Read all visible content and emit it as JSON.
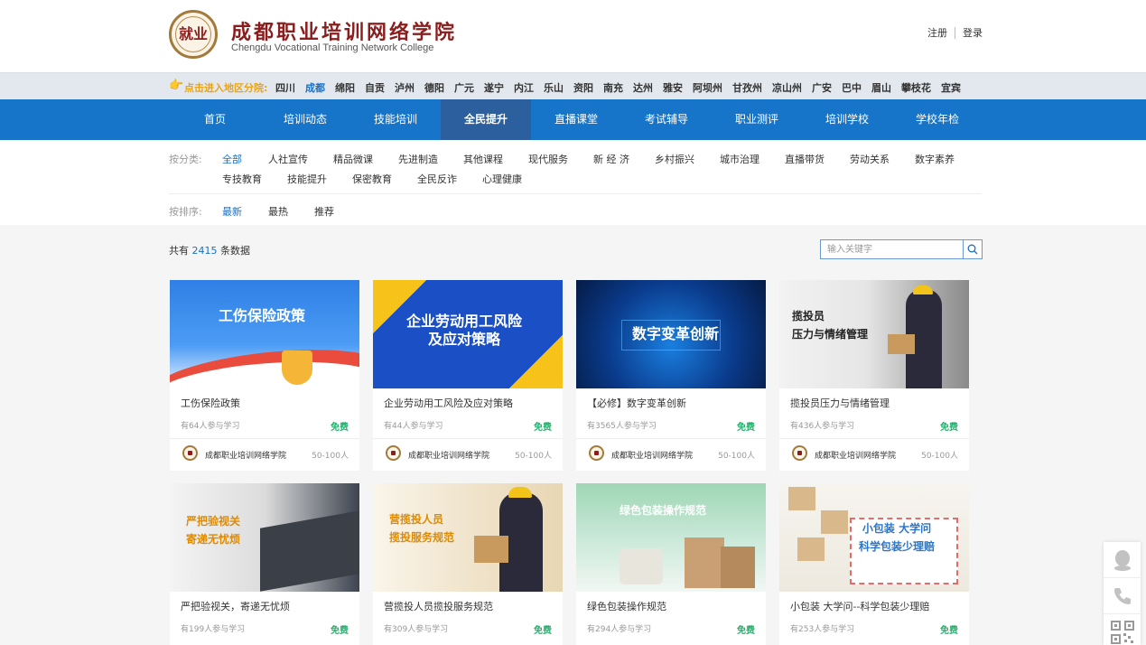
{
  "header": {
    "logo_text": "就业",
    "title_cn": "成都职业培训网络学院",
    "title_en": "Chengdu Vocational Training Network College",
    "register": "注册",
    "login": "登录"
  },
  "region_bar": {
    "label": "点击进入地区分院:",
    "regions": [
      "四川",
      "成都",
      "绵阳",
      "自贡",
      "泸州",
      "德阳",
      "广元",
      "遂宁",
      "内江",
      "乐山",
      "资阳",
      "南充",
      "达州",
      "雅安",
      "阿坝州",
      "甘孜州",
      "凉山州",
      "广安",
      "巴中",
      "眉山",
      "攀枝花",
      "宜宾"
    ],
    "active": "成都"
  },
  "nav": {
    "items": [
      "首页",
      "培训动态",
      "技能培训",
      "全民提升",
      "直播课堂",
      "考试辅导",
      "职业测评",
      "培训学校",
      "学校年检"
    ],
    "active": "全民提升"
  },
  "filter": {
    "category_label": "按分类:",
    "categories_row1": [
      "全部",
      "人社宣传",
      "精品微课",
      "先进制造",
      "其他课程",
      "现代服务",
      "新 经 济",
      "乡村振兴",
      "城市治理",
      "直播带货",
      "劳动关系",
      "数字素养"
    ],
    "categories_row2": [
      "专技教育",
      "技能提升",
      "保密教育",
      "全民反诈",
      "心理健康"
    ],
    "active_category": "全部",
    "sort_label": "按排序:",
    "sorts": [
      "最新",
      "最热",
      "推荐"
    ],
    "active_sort": "最新"
  },
  "results": {
    "prefix": "共有",
    "count": "2415",
    "suffix": "条数据"
  },
  "search": {
    "placeholder": "输入关键字"
  },
  "cards": [
    {
      "thumb_text": "工伤保险政策",
      "title": "工伤保险政策",
      "learners": "有64人参与学习",
      "price": "免费",
      "org": "成都职业培训网络学院",
      "size": "50-100人"
    },
    {
      "thumb_text": "企业劳动用工风险\n及应对策略",
      "title": "企业劳动用工风险及应对策略",
      "learners": "有44人参与学习",
      "price": "免费",
      "org": "成都职业培训网络学院",
      "size": "50-100人"
    },
    {
      "thumb_text": "数字变革创新",
      "title": "【必修】数字变革创新",
      "learners": "有3565人参与学习",
      "price": "免费",
      "org": "成都职业培训网络学院",
      "size": "50-100人"
    },
    {
      "thumb_text": "揽投员\n压力与情绪管理",
      "title": "揽投员压力与情绪管理",
      "learners": "有436人参与学习",
      "price": "免费",
      "org": "成都职业培训网络学院",
      "size": "50-100人"
    },
    {
      "thumb_text": "严把验视关\n寄递无忧烦",
      "title": "严把验视关，寄递无忧烦",
      "learners": "有199人参与学习",
      "price": "免费"
    },
    {
      "thumb_text": "营揽投人员\n揽投服务规范",
      "title": "营揽投人员揽投服务规范",
      "learners": "有309人参与学习",
      "price": "免费"
    },
    {
      "thumb_text": "绿色包装操作规范",
      "title": "绿色包装操作规范",
      "learners": "有294人参与学习",
      "price": "免费"
    },
    {
      "thumb_text": "小包装 大学问\n科学包装少理赔",
      "title": "小包装 大学问--科学包装少理赔",
      "learners": "有253人参与学习",
      "price": "免费"
    }
  ],
  "colors": {
    "primary": "#1775c9",
    "nav_active": "#2c5f9e",
    "link_active": "#1a6fc4",
    "free": "#27b06e",
    "region_label": "#e8a317",
    "brand_red": "#8a1d1d"
  },
  "side_icons": [
    "qq-icon",
    "phone-icon",
    "qrcode-icon"
  ]
}
